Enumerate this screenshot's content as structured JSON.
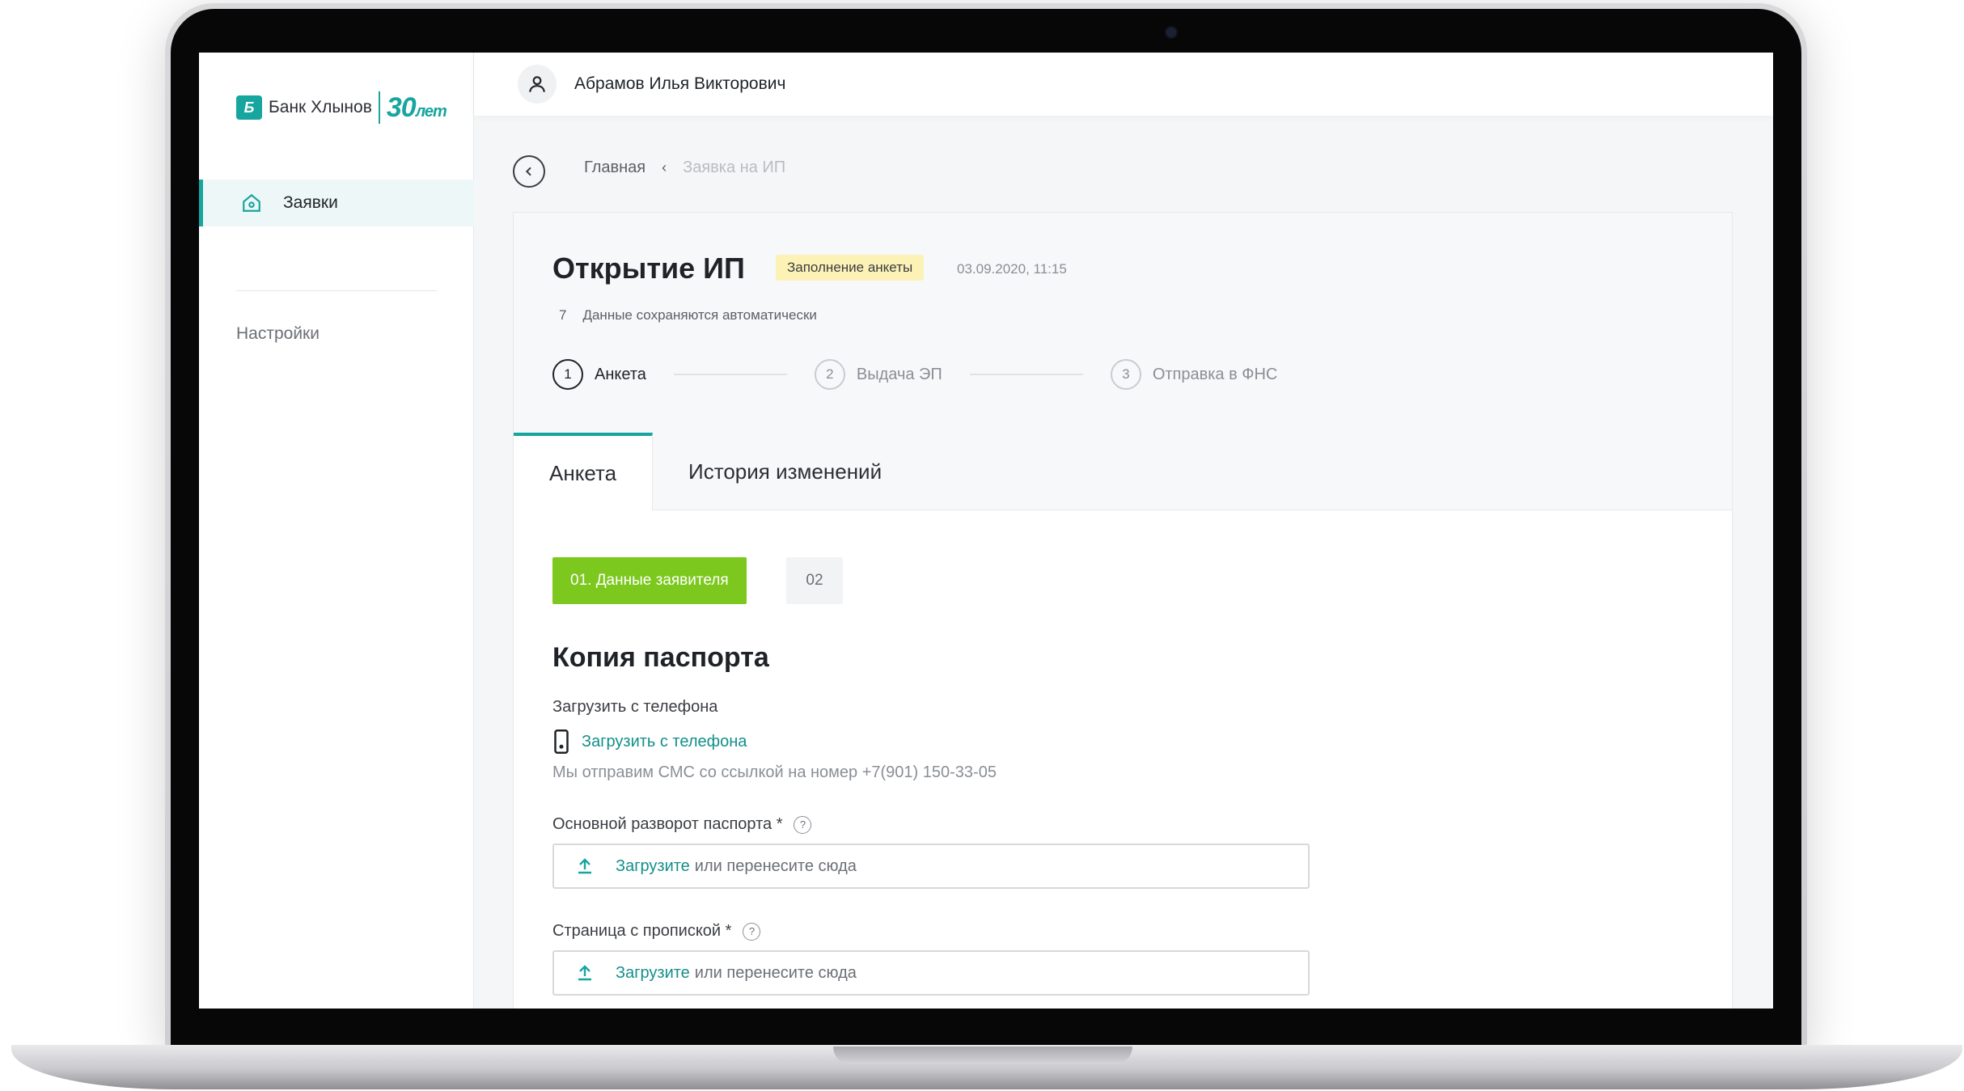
{
  "brand": {
    "logo_mark": "Б",
    "name": "Банк Хлынов",
    "anniversary_num": "30",
    "anniversary_word": "лет",
    "accent_color": "#17a59f"
  },
  "sidebar": {
    "items": [
      {
        "label": "Заявки",
        "icon": "home-icon",
        "active": true
      },
      {
        "label": "Настройки",
        "active": false
      }
    ]
  },
  "header": {
    "user_icon": "user-icon",
    "user_name": "Абрамов Илья Викторович"
  },
  "breadcrumb": {
    "back_icon": "chevron-left-icon",
    "home": "Главная",
    "separator": "‹",
    "current": "Заявка на ИП"
  },
  "application": {
    "title": "Открытие ИП",
    "status": "Заполнение анкеты",
    "status_color": "#fdf2b6",
    "datetime": "03.09.2020, 11:15",
    "autosave_num": "7",
    "autosave_text": "Данные сохраняются автоматически"
  },
  "steps": [
    {
      "num": "1",
      "label": "Анкета",
      "active": true
    },
    {
      "num": "2",
      "label": "Выдача ЭП",
      "active": false
    },
    {
      "num": "3",
      "label": "Отправка в ФНС",
      "active": false
    }
  ],
  "tabs": [
    {
      "label": "Анкета",
      "active": true
    },
    {
      "label": "История изменений",
      "active": false
    }
  ],
  "form": {
    "sections": [
      {
        "label": "01. Данные заявителя",
        "active": true,
        "color": "#7cc81e"
      },
      {
        "label": "02",
        "active": false
      }
    ],
    "section_title": "Копия паспорта",
    "phone_upload_label": "Загрузить с телефона",
    "phone_upload_icon": "phone-icon",
    "phone_upload_link": "Загрузить с телефона",
    "phone_upload_hint": "Мы отправим СМС со ссылкой на номер +7(901) 150-33-05",
    "fields": [
      {
        "label": "Основной разворот паспорта *",
        "help": "?",
        "upload_link": "Загрузите",
        "upload_rest": "или перенесите сюда",
        "icon": "upload-icon"
      },
      {
        "label": "Страница с пропиской *",
        "help": "?",
        "upload_link": "Загрузите",
        "upload_rest": "или перенесите сюда",
        "icon": "upload-icon"
      }
    ]
  }
}
